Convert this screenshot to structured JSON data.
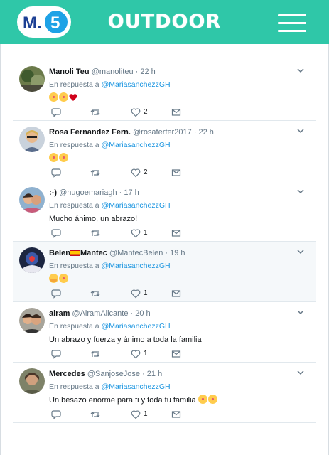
{
  "header": {
    "logo_text": "M.5",
    "brand": "OUTDOOR",
    "menu_icon": "hamburger-menu-icon"
  },
  "colors": {
    "header_bg": "#2fc7a8",
    "mention": "#1b95e0",
    "highlight_row": "#f5f8fa"
  },
  "tweets": [
    {
      "name": "Manoli Teu",
      "handle": "@manoliteu",
      "dot": "·",
      "time": "22 h",
      "reply_prefix": "En respuesta a",
      "reply_to": "@MariasanchezzGH",
      "text": "",
      "emojis": [
        "face-blowing-kiss",
        "face-blowing-kiss",
        "red-heart"
      ],
      "likes": "2"
    },
    {
      "name": "Rosa Fernandez Fern.",
      "handle": "@rosaferfer2017",
      "dot": "·",
      "time": "22 h",
      "reply_prefix": "En respuesta a",
      "reply_to": "@MariasanchezzGH",
      "text": "",
      "emojis": [
        "face-blowing-kiss",
        "face-blowing-kiss"
      ],
      "likes": "2"
    },
    {
      "name": ":-)",
      "handle": "@hugoemariagh",
      "dot": "·",
      "time": "17 h",
      "reply_prefix": "En respuesta a",
      "reply_to": "@MariasanchezzGH",
      "text": "Mucho ánimo, un abrazo!",
      "emojis": [],
      "likes": "1"
    },
    {
      "name": "Belen",
      "name_suffix": "Mantec",
      "handle": "@MantecBelen",
      "dot": "·",
      "time": "19 h",
      "reply_prefix": "En respuesta a",
      "reply_to": "@MariasanchezzGH",
      "text": "",
      "emojis": [
        "hugging-face",
        "face-blowing-kiss"
      ],
      "likes": "1"
    },
    {
      "name": "airam",
      "handle": "@AiramAlicante",
      "dot": "·",
      "time": "20 h",
      "reply_prefix": "En respuesta a",
      "reply_to": "@MariasanchezzGH",
      "text": "Un abrazo y fuerza y ánimo a toda la familia",
      "emojis": [],
      "likes": "1"
    },
    {
      "name": "Mercedes",
      "handle": "@SanjoseJose",
      "dot": "·",
      "time": "21 h",
      "reply_prefix": "En respuesta a",
      "reply_to": "@MariasanchezzGH",
      "text": "Un besazo enorme para ti y toda tu familia",
      "emojis": [
        "kissing-face",
        "kissing-face"
      ],
      "likes": "1"
    }
  ]
}
